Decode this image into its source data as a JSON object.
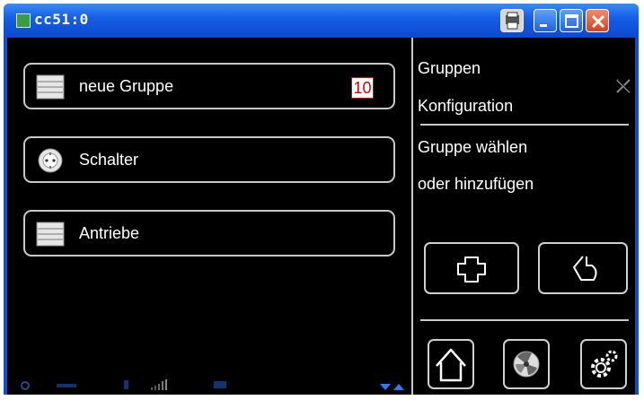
{
  "window": {
    "title": "cc51:0"
  },
  "list": {
    "items": [
      {
        "label": "neue Gruppe",
        "icon": "blind-icon",
        "badge": "10"
      },
      {
        "label": "Schalter",
        "icon": "socket-icon"
      },
      {
        "label": "Antriebe",
        "icon": "blind-icon"
      }
    ]
  },
  "panel": {
    "title_line1": "Gruppen",
    "title_line2": "Konfiguration",
    "text_line1": "Gruppe wählen",
    "text_line2": "oder hinzufügen"
  },
  "colors": {
    "titlebar": "#1660e6",
    "badge_text": "#e00000",
    "border": "#c8c8c8",
    "background": "#000000"
  }
}
